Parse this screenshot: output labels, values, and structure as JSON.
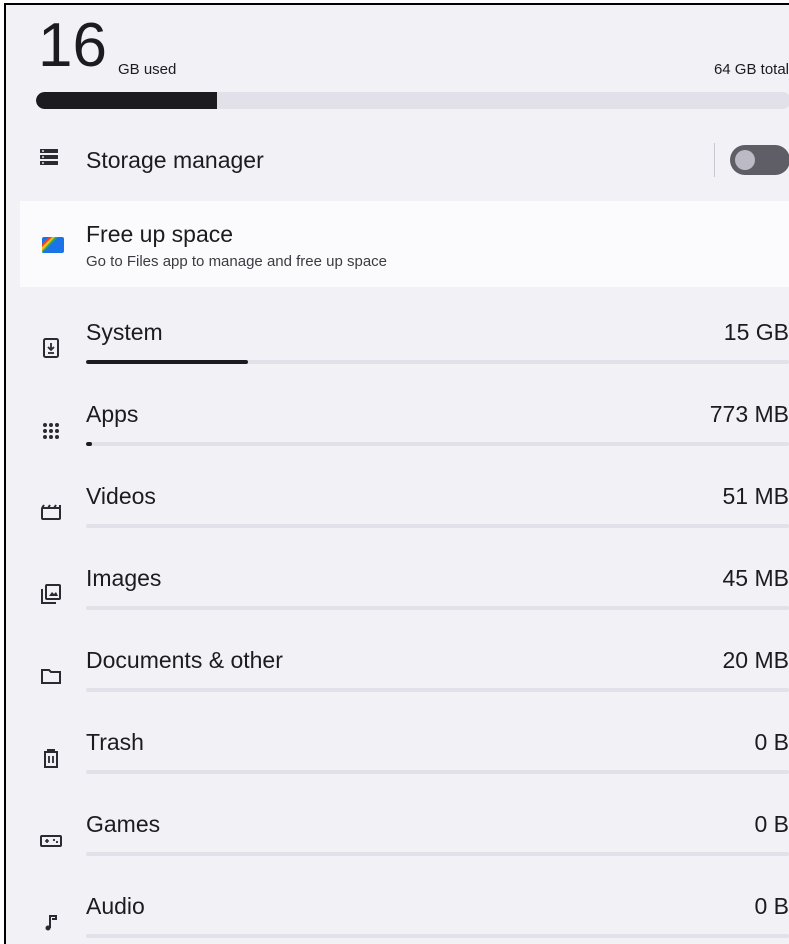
{
  "summary": {
    "used_value": "16",
    "used_label": "GB used",
    "total_label": "64 GB total",
    "used_fraction": 0.24
  },
  "storage_manager": {
    "label": "Storage manager",
    "toggle_on": false
  },
  "free_up_space": {
    "title": "Free up space",
    "subtitle": "Go to Files app to manage and free up space"
  },
  "categories": [
    {
      "label": "System",
      "size": "15 GB",
      "fraction": 0.23,
      "icon": "system-icon"
    },
    {
      "label": "Apps",
      "size": "773 MB",
      "fraction": 0.008,
      "icon": "apps-icon"
    },
    {
      "label": "Videos",
      "size": "51 MB",
      "fraction": 0,
      "icon": "videos-icon"
    },
    {
      "label": "Images",
      "size": "45 MB",
      "fraction": 0,
      "icon": "images-icon"
    },
    {
      "label": "Documents & other",
      "size": "20 MB",
      "fraction": 0,
      "icon": "folder-icon"
    },
    {
      "label": "Trash",
      "size": "0 B",
      "fraction": 0,
      "icon": "trash-icon"
    },
    {
      "label": "Games",
      "size": "0 B",
      "fraction": 0,
      "icon": "games-icon"
    },
    {
      "label": "Audio",
      "size": "0 B",
      "fraction": 0,
      "icon": "audio-icon"
    }
  ],
  "colors": {
    "background": "#f2f1f6",
    "bar_fill": "#1c1b1f",
    "bar_track": "#e2e1ea"
  }
}
